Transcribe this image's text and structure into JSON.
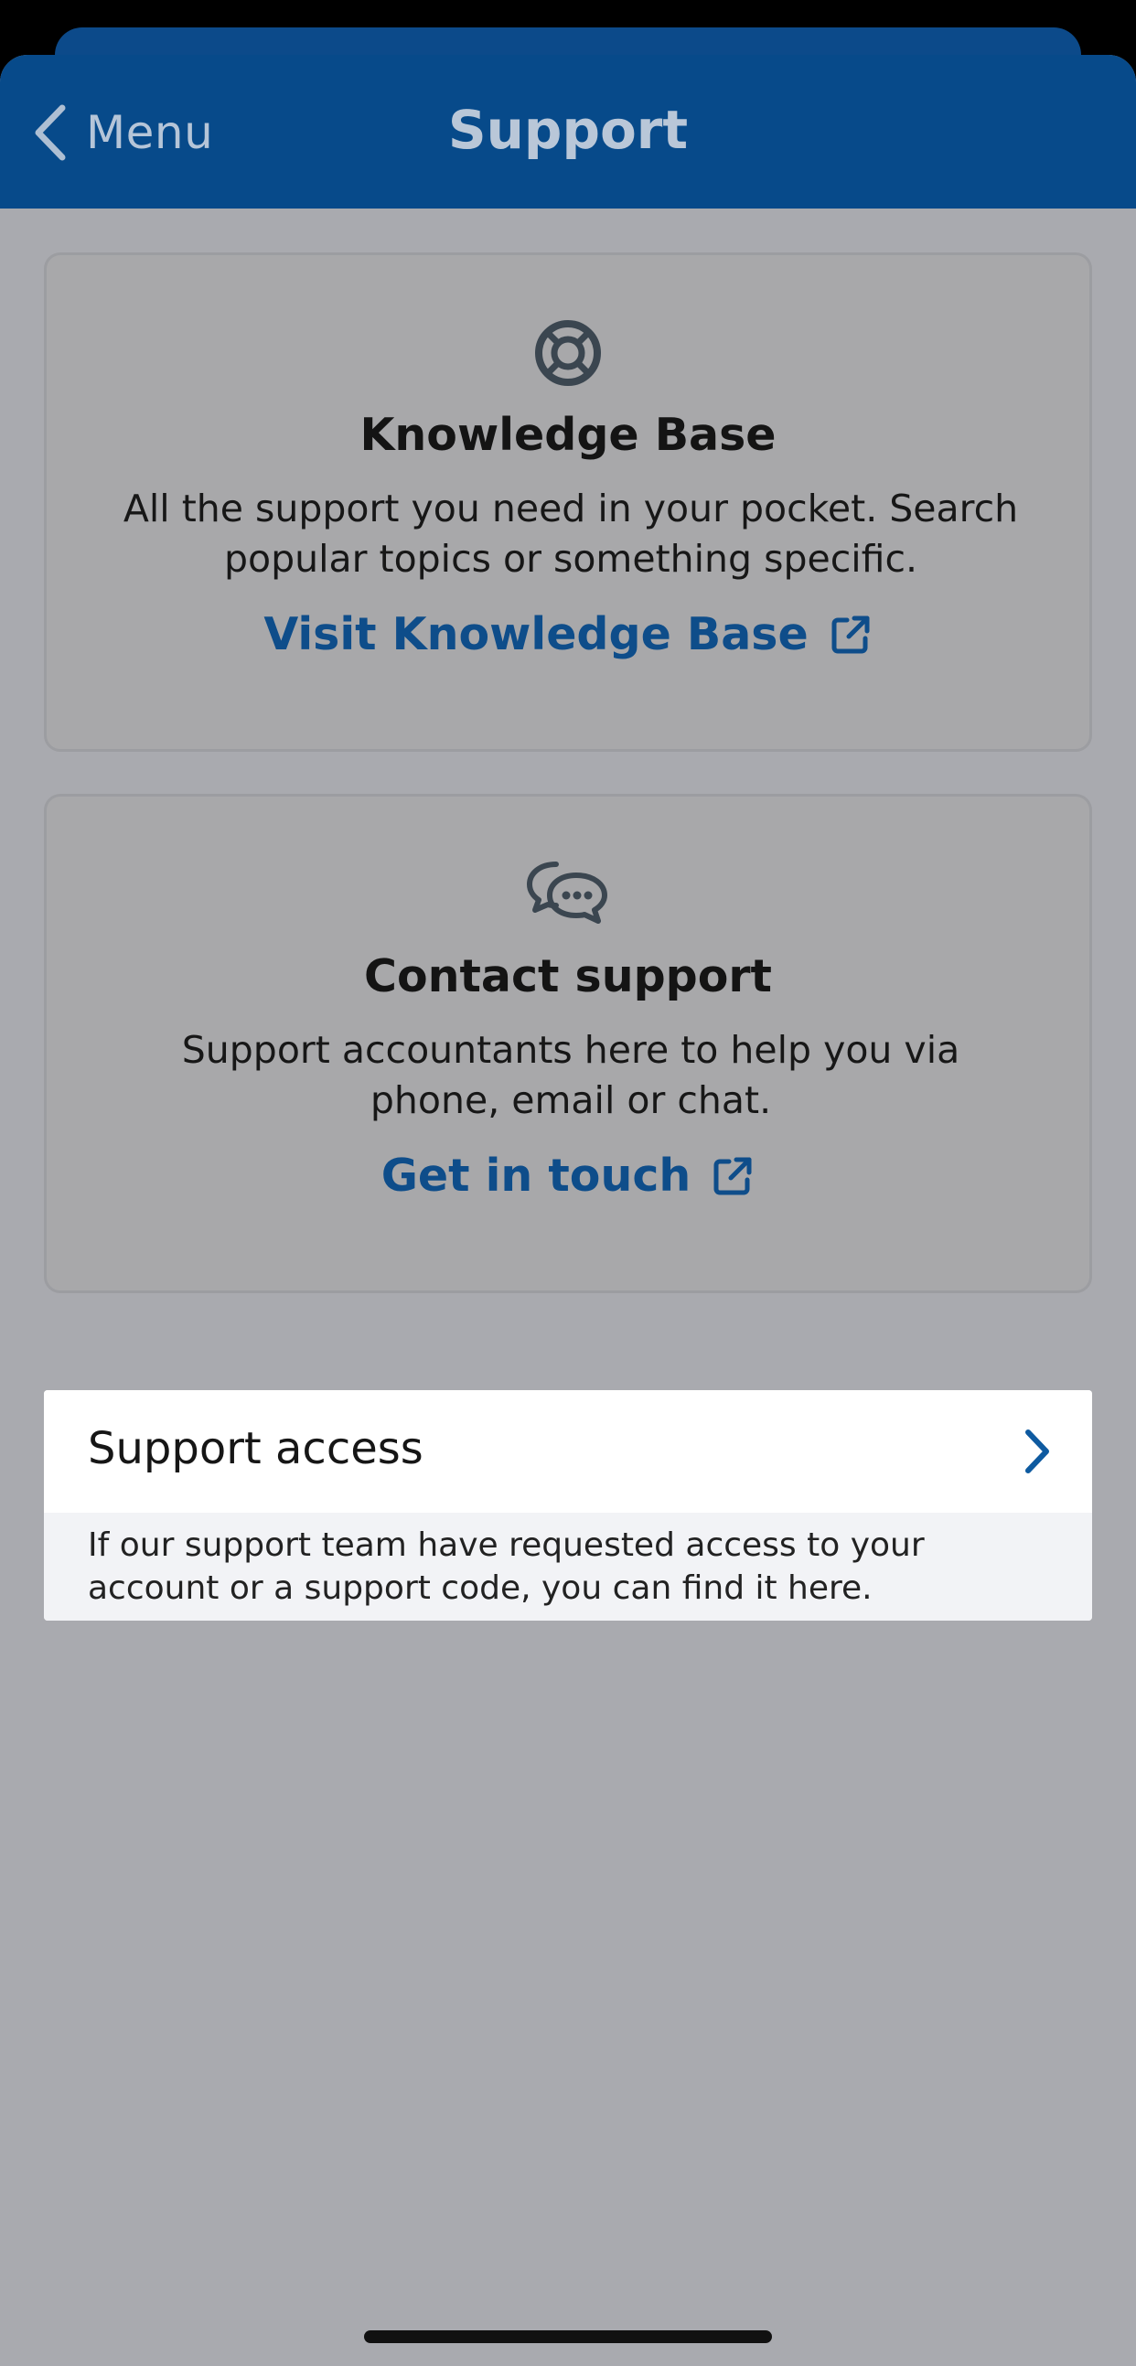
{
  "nav": {
    "back_label": "Menu",
    "title": "Support"
  },
  "knowledge_base": {
    "icon": "lifebuoy-icon",
    "title": "Knowledge Base",
    "description": "All the support you need in your pocket. Search popular topics or something specific.",
    "link_label": "Visit Knowledge Base",
    "link_icon": "external-link-icon"
  },
  "contact_support": {
    "icon": "chat-bubbles-icon",
    "title": "Contact support",
    "description": "Support accountants here to help you via phone, email or chat.",
    "link_label": "Get in touch",
    "link_icon": "external-link-icon"
  },
  "support_access": {
    "title": "Support access",
    "note": "If our support team have requested access to your account or a support code, you can find it here."
  },
  "colors": {
    "nav_bg": "#074a8a",
    "link": "#0e4d8a",
    "overlay_bg": "#a9aaaf"
  }
}
